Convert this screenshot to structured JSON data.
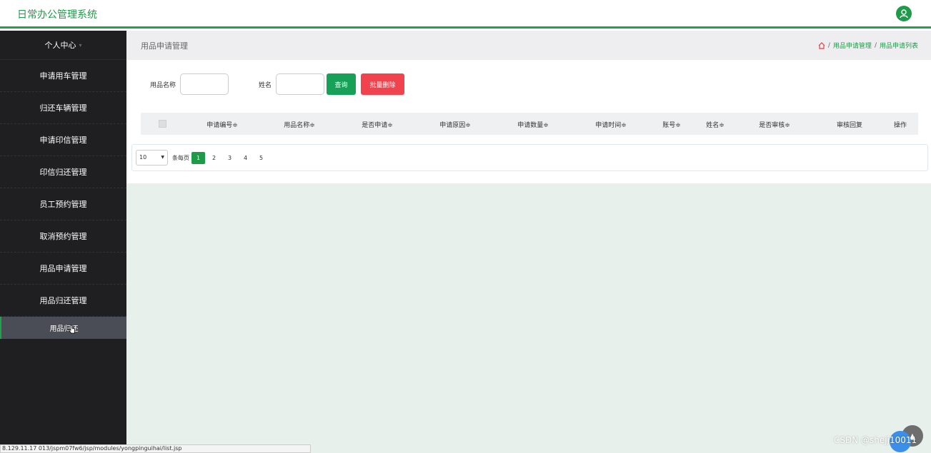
{
  "app": {
    "title": "日常办公管理系统"
  },
  "sidebar": {
    "header": "个人中心",
    "items": [
      {
        "label": "申请用车管理"
      },
      {
        "label": "归还车辆管理"
      },
      {
        "label": "申请印信管理"
      },
      {
        "label": "印信归还管理"
      },
      {
        "label": "员工预约管理"
      },
      {
        "label": "取消预约管理"
      },
      {
        "label": "用品申请管理"
      },
      {
        "label": "用品归还管理"
      }
    ],
    "sub_item": "用品归还"
  },
  "header": {
    "page_title": "用品申请管理",
    "breadcrumb": [
      "用品申请管理",
      "用品申请列表"
    ],
    "separator": "/"
  },
  "search": {
    "field1_label": "用品名称",
    "field1_value": "",
    "field2_label": "姓名",
    "field2_value": "",
    "query_button": "查询",
    "batch_delete_button": "批量删除"
  },
  "table": {
    "columns": [
      {
        "label": "申请编号≑"
      },
      {
        "label": "用品名称≑"
      },
      {
        "label": "是否申请≑"
      },
      {
        "label": "申请原因≑"
      },
      {
        "label": "申请数量≑"
      },
      {
        "label": "申请时间≑"
      },
      {
        "label": "账号≑"
      },
      {
        "label": "姓名≑"
      },
      {
        "label": "是否审核≑"
      },
      {
        "label": "审核回复"
      },
      {
        "label": "操作"
      }
    ],
    "rows": []
  },
  "pagination": {
    "page_size": "10",
    "per_page_label": "条每页",
    "pages": [
      "1",
      "2",
      "3",
      "4",
      "5"
    ],
    "current_page": "1"
  },
  "statusbar": {
    "url": "8.129.11.17 013/jspm07fw6/jsp/modules/yongpinguihai/list.jsp"
  },
  "watermark": "CSDN @shejj10011",
  "colors": {
    "accent": "#1e9a48",
    "danger": "#f0434d",
    "sidebar_bg": "#1f1f22",
    "content_bg": "#e7f0eb"
  }
}
